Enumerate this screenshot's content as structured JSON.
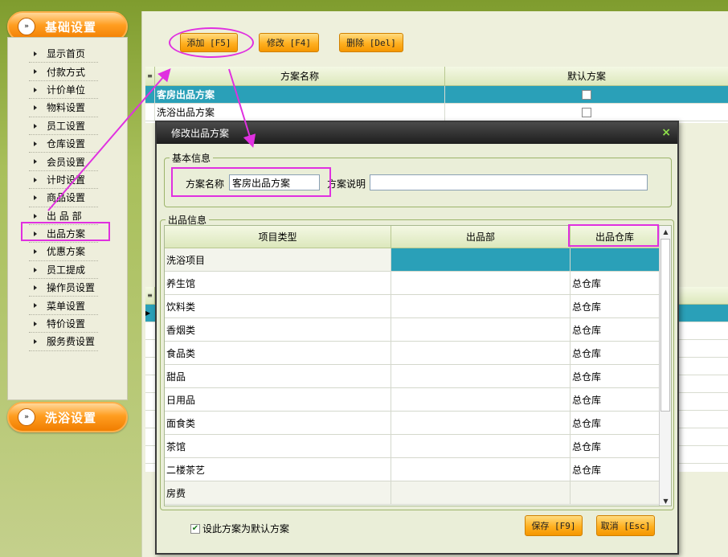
{
  "sidebar": {
    "section_basic": "基础设置",
    "section_bath": "洗浴设置",
    "items": [
      {
        "label": "显示首页"
      },
      {
        "label": "付款方式"
      },
      {
        "label": "计价单位"
      },
      {
        "label": "物料设置"
      },
      {
        "label": "员工设置"
      },
      {
        "label": "仓库设置"
      },
      {
        "label": "会员设置"
      },
      {
        "label": "计时设置"
      },
      {
        "label": "商品设置"
      },
      {
        "label": "出 品 部"
      },
      {
        "label": "出品方案"
      },
      {
        "label": "优惠方案"
      },
      {
        "label": "员工提成"
      },
      {
        "label": "操作员设置"
      },
      {
        "label": "菜单设置"
      },
      {
        "label": "特价设置"
      },
      {
        "label": "服务费设置"
      }
    ],
    "selected_index": 10
  },
  "toolbar": {
    "add_label": "添加 [F5]",
    "edit_label": "修改 [F4]",
    "delete_label": "删除 [Del]"
  },
  "plan_grid": {
    "columns": [
      "方案名称",
      "默认方案"
    ],
    "rows": [
      {
        "name": "客房出品方案",
        "default": true,
        "selected": true
      },
      {
        "name": "洗浴出品方案",
        "default": false,
        "selected": false
      }
    ]
  },
  "dialog": {
    "title": "修改出品方案",
    "close_glyph": "×",
    "basic_group_label": "基本信息",
    "name_label": "方案名称",
    "name_value": "客房出品方案",
    "desc_label": "方案说明",
    "desc_value": "",
    "output_group_label": "出品信息",
    "columns": [
      "项目类型",
      "出品部",
      "出品仓库"
    ],
    "rows": [
      {
        "type": "洗浴项目",
        "dept": "",
        "warehouse": "",
        "highlight": true
      },
      {
        "type": "养生馆",
        "dept": "",
        "warehouse": "总仓库"
      },
      {
        "type": "饮料类",
        "dept": "",
        "warehouse": "总仓库"
      },
      {
        "type": "香烟类",
        "dept": "",
        "warehouse": "总仓库"
      },
      {
        "type": "食品类",
        "dept": "",
        "warehouse": "总仓库"
      },
      {
        "type": "甜品",
        "dept": "",
        "warehouse": "总仓库"
      },
      {
        "type": "日用品",
        "dept": "",
        "warehouse": "总仓库"
      },
      {
        "type": "面食类",
        "dept": "",
        "warehouse": "总仓库"
      },
      {
        "type": "茶馆",
        "dept": "",
        "warehouse": "总仓库"
      },
      {
        "type": "二楼茶艺",
        "dept": "",
        "warehouse": "总仓库"
      },
      {
        "type": "房费",
        "dept": "",
        "warehouse": ""
      }
    ],
    "default_checkbox_label": "设此方案为默认方案",
    "default_checked": true,
    "save_label": "保存 [F9]",
    "cancel_label": "取消 [Esc]"
  },
  "colors": {
    "accent_orange": "#ff9d20",
    "selection_teal": "#2aa0b8",
    "annotation_magenta": "#e030e0"
  }
}
